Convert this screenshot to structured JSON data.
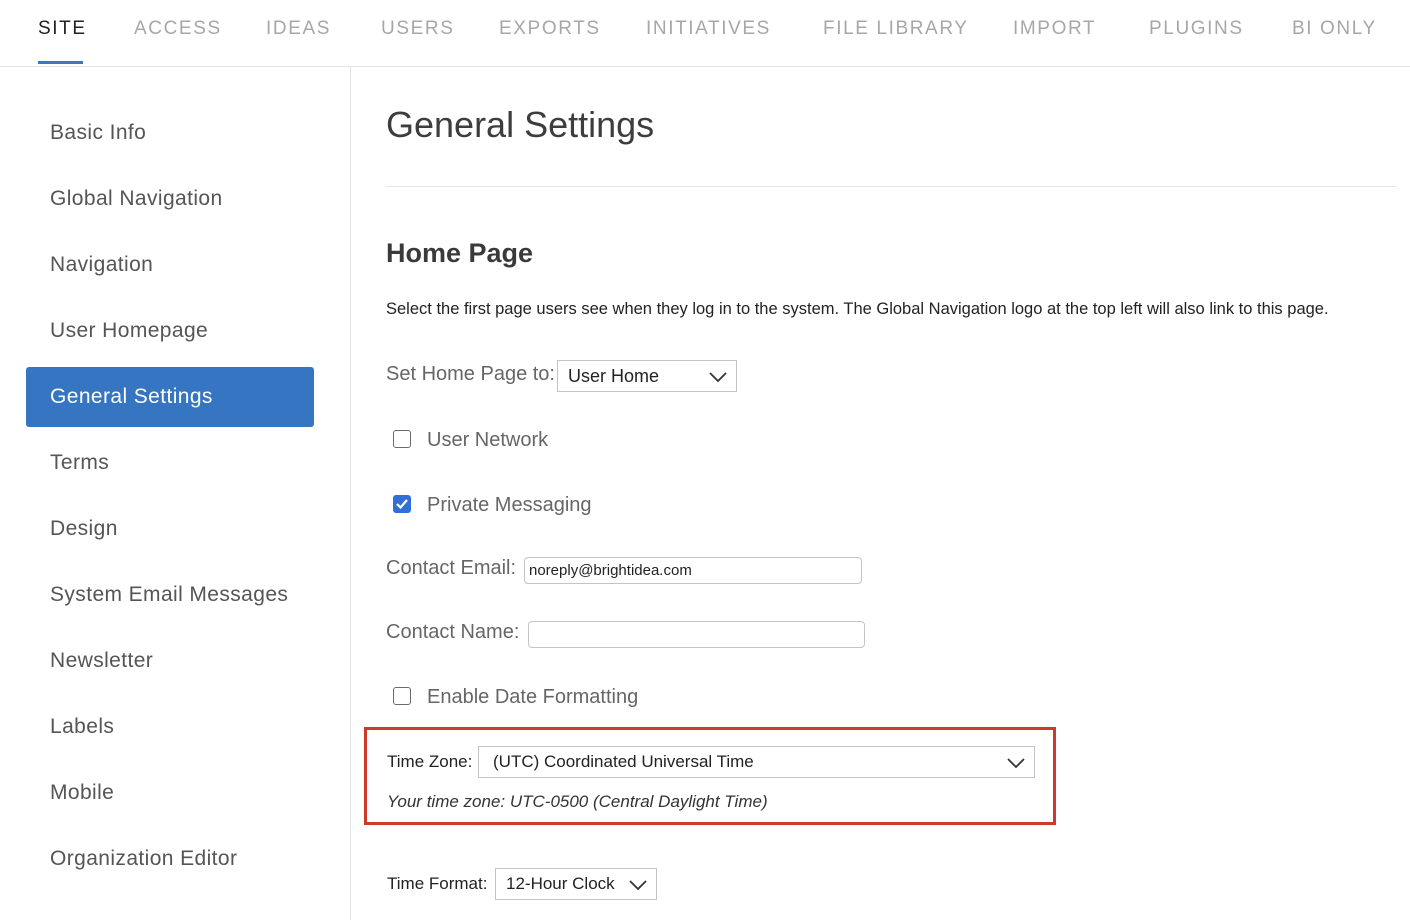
{
  "tabs": [
    {
      "label": "SITE",
      "active": true
    },
    {
      "label": "ACCESS"
    },
    {
      "label": "IDEAS"
    },
    {
      "label": "USERS"
    },
    {
      "label": "EXPORTS"
    },
    {
      "label": "INITIATIVES"
    },
    {
      "label": "FILE LIBRARY"
    },
    {
      "label": "IMPORT"
    },
    {
      "label": "PLUGINS"
    },
    {
      "label": "BI ONLY"
    }
  ],
  "sidebar": {
    "items": [
      {
        "label": "Basic Info"
      },
      {
        "label": "Global Navigation"
      },
      {
        "label": "Navigation"
      },
      {
        "label": "User Homepage"
      },
      {
        "label": "General Settings",
        "active": true
      },
      {
        "label": "Terms"
      },
      {
        "label": "Design"
      },
      {
        "label": "System Email Messages"
      },
      {
        "label": "Newsletter"
      },
      {
        "label": "Labels"
      },
      {
        "label": "Mobile"
      },
      {
        "label": "Organization Editor"
      }
    ]
  },
  "main": {
    "title": "General Settings",
    "home_page": {
      "heading": "Home Page",
      "description": "Select the first page users see when they log in to the system. The Global Navigation logo at the top left will also link to this page.",
      "set_home_label": "Set Home Page to:",
      "set_home_value": "User Home",
      "user_network_label": "User Network",
      "user_network_checked": false,
      "private_messaging_label": "Private Messaging",
      "private_messaging_checked": true,
      "contact_email_label": "Contact Email:",
      "contact_email_value": "noreply@brightidea.com",
      "contact_name_label": "Contact Name:",
      "contact_name_value": "",
      "date_formatting_label": "Enable Date Formatting",
      "date_formatting_checked": false,
      "time_zone_label": "Time Zone:",
      "time_zone_value": "(UTC) Coordinated Universal Time",
      "time_zone_note": "Your time zone: UTC-0500 (Central Daylight Time)",
      "time_format_label": "Time Format:",
      "time_format_value": "12-Hour Clock"
    }
  },
  "colors": {
    "accent": "#3675c2",
    "checkbox_checked": "#2f6fd6",
    "highlight_border": "#cc3a2a"
  }
}
